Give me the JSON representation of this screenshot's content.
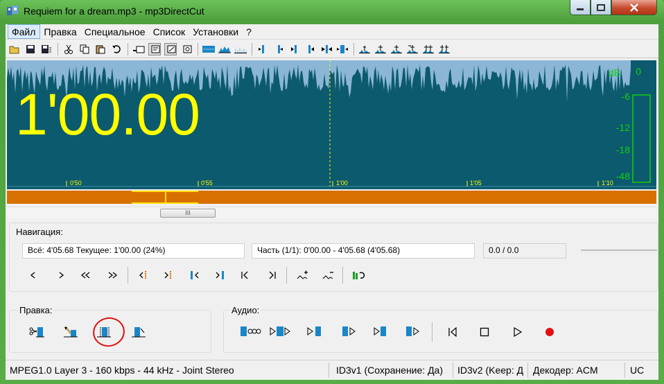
{
  "window": {
    "title": "Requiem for a dream.mp3 - mp3DirectCut",
    "close_color": "#c64a2c"
  },
  "menu": {
    "items": [
      "Файл",
      "Правка",
      "Специальное",
      "Список",
      "Установки",
      "?"
    ],
    "active": "Файл"
  },
  "toolbar": {
    "icons": [
      "open-icon",
      "save-icon",
      "save-selection-icon",
      "cut-icon",
      "copy-icon",
      "paste-icon",
      "undo-icon",
      "cue-view-1-icon",
      "cue-view-2-icon",
      "cue-view-3-icon",
      "cue-view-4-icon",
      "view-wave-icon",
      "view-level-icon",
      "view-dots-icon",
      "set-begin-icon",
      "set-end-icon",
      "jump-begin-icon",
      "jump-end-icon",
      "expand-icon",
      "fit-icon",
      "cue-prev-icon",
      "cue-add-icon",
      "cue-next-icon",
      "cue-split-icon",
      "cue-merge-icon",
      "cue-auto-icon"
    ]
  },
  "waveform": {
    "time_display": "1'00.00",
    "db_labels": [
      "dB",
      "-6",
      "-12",
      "-18",
      "-48"
    ],
    "tick_labels": [
      "0'50",
      "0'55",
      "1'00",
      "1'05",
      "1'10"
    ],
    "level_meter_label": "0",
    "colors": {
      "wave_bg": "#0c5a6d",
      "wave_peak": "#8bb6d6",
      "display": "#ffff00",
      "meter": "#10d010",
      "overview": "#d77000"
    }
  },
  "scrollbar": {
    "thumb_grip": "III"
  },
  "navigation": {
    "caption": "Навигация:",
    "total": "Всё: 4'05.68  Текущее: 1'00.00  (24%)",
    "part": "Часть (1/1): 0'00.00 - 4'05.68 (4'05.68)",
    "selection": "0.0 / 0.0",
    "buttons": [
      "prev-frame-icon",
      "next-frame-icon",
      "rewind-icon",
      "fast-forward-icon",
      "go-begin-mark-icon",
      "go-end-mark-icon",
      "sel-begin-icon",
      "sel-end-icon",
      "go-start-icon",
      "go-end-icon",
      "zoom-in-icon",
      "zoom-out-icon",
      "auto-scroll-icon"
    ]
  },
  "edit": {
    "caption": "Правка:",
    "buttons": [
      "cut-selection-icon",
      "paste-fade-icon",
      "fade-in-icon",
      "fade-out-icon"
    ]
  },
  "audio": {
    "caption": "Аудио:",
    "buttons": [
      "play-loop-icon",
      "play-selection-icon",
      "play-to-end-icon",
      "play-from-begin-icon",
      "play-end-icon",
      "play-split-icon",
      "prev-track-icon",
      "stop-icon",
      "play-icon",
      "record-icon"
    ]
  },
  "status": {
    "format": "MPEG1.0 Layer 3 - 160 kbps - 44 kHz - Joint Stereo",
    "id3v1": "ID3v1 (Сохранение: Да)",
    "id3v2": "ID3v2 (Keep: Д",
    "decoder": "Декодер: ACM",
    "mode": "UC"
  }
}
